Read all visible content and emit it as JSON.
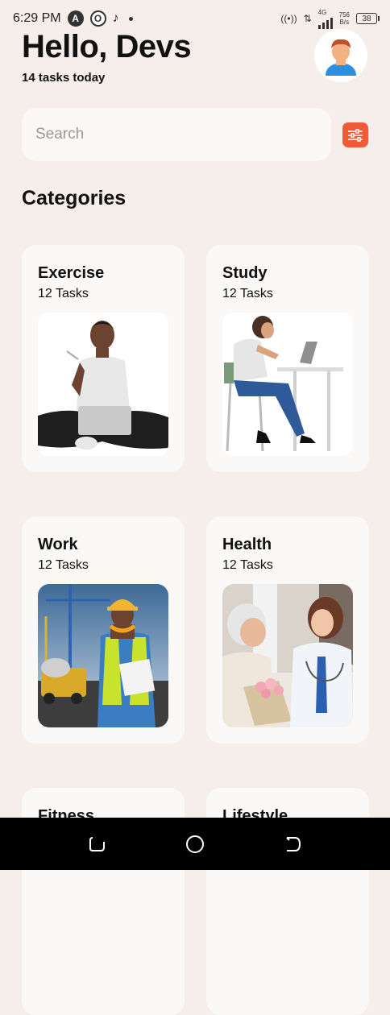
{
  "status_bar": {
    "time": "6:29 PM",
    "network": "4G",
    "speed_value": "756",
    "speed_unit": "B/s",
    "battery": "38"
  },
  "header": {
    "greeting": "Hello, Devs",
    "subtitle": "14 tasks today",
    "avatar_icon": "user-avatar-icon"
  },
  "search": {
    "placeholder": "Search",
    "value": "",
    "filter_icon": "sliders-icon"
  },
  "categories": {
    "title": "Categories",
    "items": [
      {
        "title": "Exercise",
        "count": "12 Tasks",
        "image": "person-with-laptop-image"
      },
      {
        "title": "Study",
        "count": "12 Tasks",
        "image": "person-studying-at-desk-image"
      },
      {
        "title": "Work",
        "count": "12 Tasks",
        "image": "construction-worker-image"
      },
      {
        "title": "Health",
        "count": "12 Tasks",
        "image": "nurse-with-patient-image"
      },
      {
        "title": "Fitness",
        "count": "",
        "image": ""
      },
      {
        "title": "Lifestyle",
        "count": "",
        "image": ""
      }
    ]
  },
  "colors": {
    "background": "#f6eeea",
    "card": "#fbf9f7",
    "accent": "#f05a37",
    "nav_bar": "#000000"
  },
  "nav": {
    "back_icon": "back-icon",
    "home_icon": "home-icon",
    "recents_icon": "recents-icon"
  }
}
